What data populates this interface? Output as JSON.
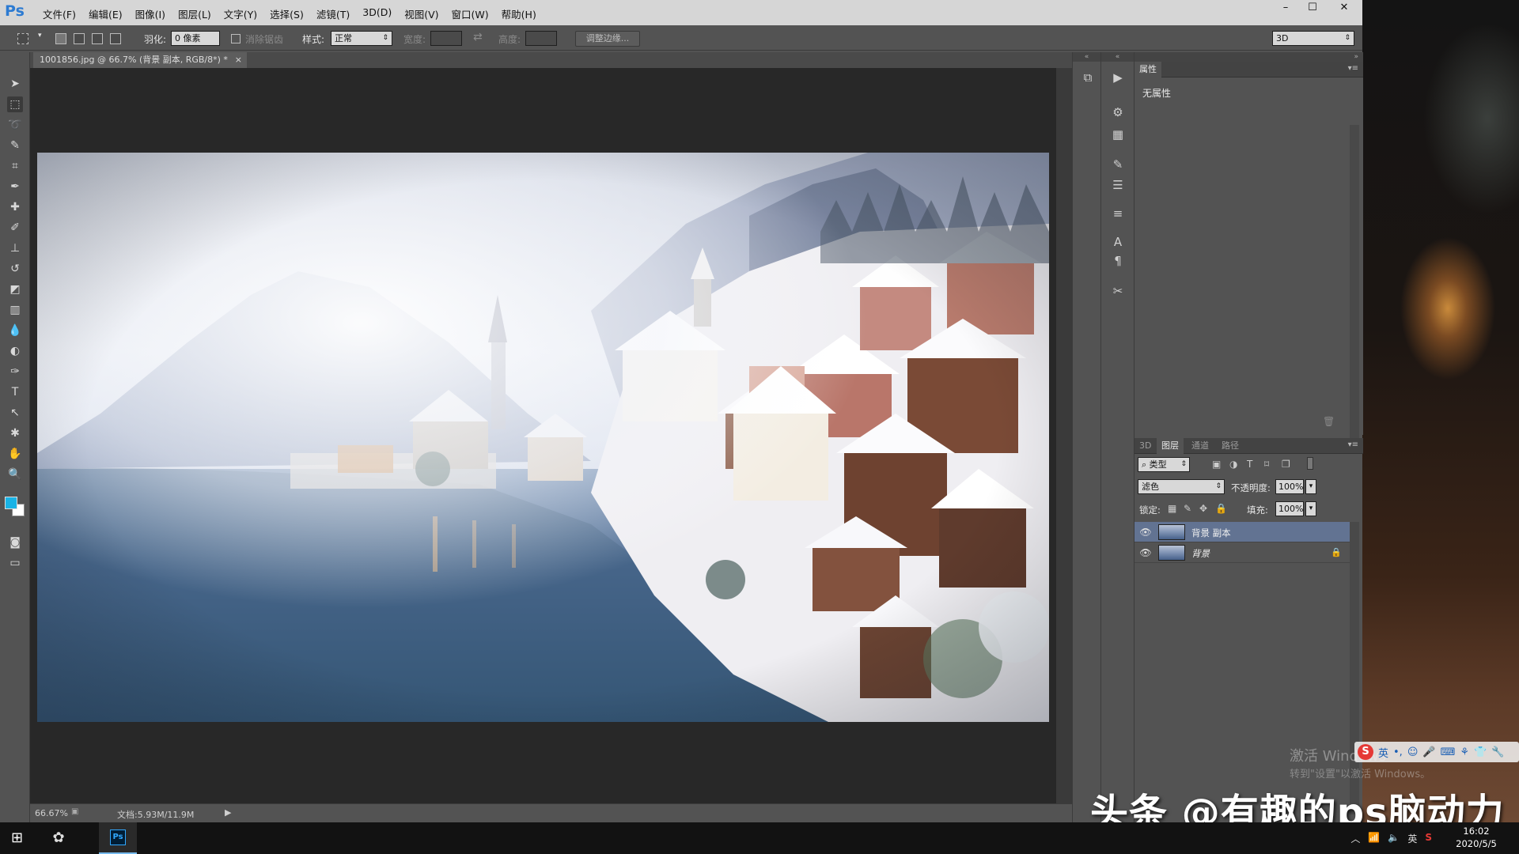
{
  "app": {
    "logo": "Ps",
    "menus": [
      "文件(F)",
      "编辑(E)",
      "图像(I)",
      "图层(L)",
      "文字(Y)",
      "选择(S)",
      "滤镜(T)",
      "3D(D)",
      "视图(V)",
      "窗口(W)",
      "帮助(H)"
    ],
    "window_controls": {
      "minimize": "–",
      "maximize": "☐",
      "close": "✕"
    }
  },
  "options": {
    "feather_label": "羽化:",
    "feather_value": "0 像素",
    "antialias_label": "消除锯齿",
    "style_label": "样式:",
    "style_value": "正常",
    "width_label": "宽度:",
    "height_label": "高度:",
    "refine_edge": "调整边缘...",
    "workspace": "3D"
  },
  "document": {
    "tab_title": "1001856.jpg @ 66.7% (背景 副本, RGB/8*) *",
    "tab_close": "×",
    "zoom": "66.67%",
    "doc_size": "文档:5.93M/11.9M"
  },
  "properties_panel": {
    "tab": "属性",
    "content": "无属性"
  },
  "layers_panel": {
    "tabs": [
      "3D",
      "图层",
      "通道",
      "路径"
    ],
    "active_tab": "图层",
    "filter_kind": "类型",
    "blend_mode": "滤色",
    "opacity_label": "不透明度:",
    "opacity_value": "100%",
    "lock_label": "锁定:",
    "fill_label": "填充:",
    "fill_value": "100%",
    "layers": [
      {
        "name": "背景 副本",
        "selected": true,
        "locked": false
      },
      {
        "name": "背景",
        "selected": false,
        "locked": true
      }
    ]
  },
  "desktop": {
    "activate_title": "激活 Windows",
    "activate_sub": "转到\"设置\"以激活 Windows。",
    "ime_lang": "英",
    "watermark": "头条 @有趣的ps脑动力"
  },
  "taskbar": {
    "tray_lang": "英",
    "time": "16:02",
    "date": "2020/5/5"
  },
  "colors": {
    "foreground": "#19b3e6",
    "background": "#ffffff",
    "accent": "#627392"
  }
}
